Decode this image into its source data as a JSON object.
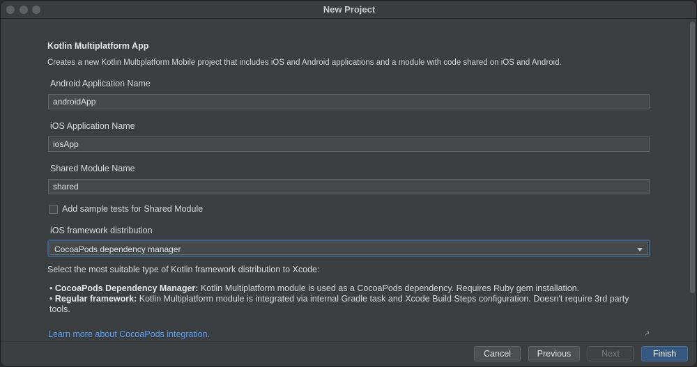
{
  "window": {
    "title": "New Project"
  },
  "main": {
    "heading": "Kotlin Multiplatform App",
    "description": "Creates a new Kotlin Multiplatform Mobile project that includes iOS and Android applications and a module with code shared on iOS and Android.",
    "android_app": {
      "label": "Android Application Name",
      "value": "androidApp"
    },
    "ios_app": {
      "label": "iOS Application Name",
      "value": "iosApp"
    },
    "shared_module": {
      "label": "Shared Module Name",
      "value": "shared"
    },
    "sample_tests": {
      "label": "Add sample tests for Shared Module",
      "checked": false
    },
    "distribution": {
      "label": "iOS framework distribution",
      "selected": "CocoaPods dependency manager"
    },
    "hint": "Select the most suitable type of Kotlin framework distribution to Xcode:",
    "bullets": [
      {
        "title": "CocoaPods Dependency Manager:",
        "text": "Kotlin Multiplatform module is used as a CocoaPods dependency. Requires Ruby gem installation."
      },
      {
        "title": "Regular framework:",
        "text": "Kotlin Multiplatform module is integrated via internal Gradle task and Xcode Build Steps configuration. Doesn't require 3rd party tools."
      }
    ],
    "link": "Learn more about CocoaPods integration."
  },
  "footer": {
    "cancel": "Cancel",
    "previous": "Previous",
    "next": "Next",
    "finish": "Finish"
  },
  "colors": {
    "background": "#3c3f41",
    "accent": "#365880",
    "link": "#589df6"
  },
  "icons": {
    "dropdown": "chevron-down-icon",
    "external_link": "external-link-icon"
  }
}
